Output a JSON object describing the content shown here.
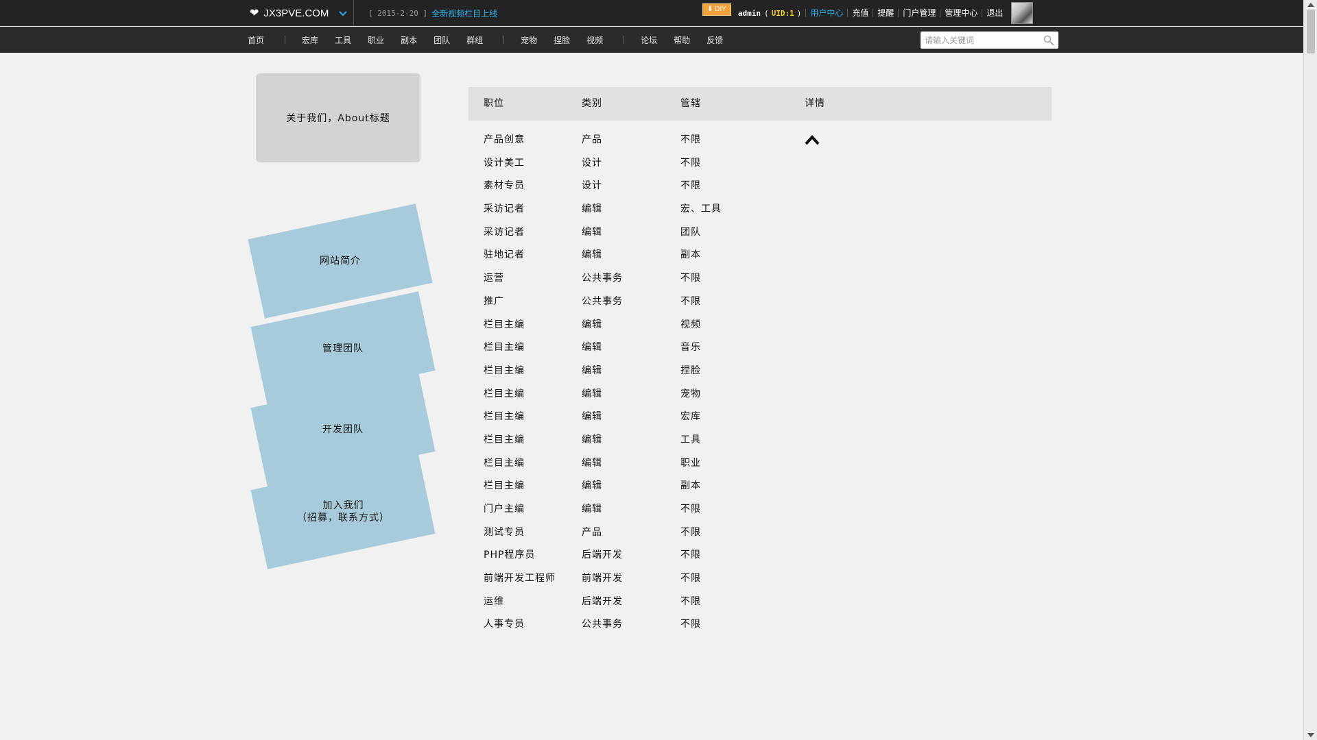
{
  "topbar": {
    "site_name": "JX3PVE.COM",
    "news_date": "[ 2015-2-20 ]",
    "news_link": "全新视频栏目上线",
    "diy_label": "DIY",
    "username": "admin",
    "uid_open": "(",
    "uid_text": "UID:1",
    "uid_close": ")",
    "links": [
      "用户中心",
      "充值",
      "提醒",
      "门户管理",
      "管理中心",
      "退出"
    ]
  },
  "nav": {
    "group1": [
      "首页"
    ],
    "group2": [
      "宏库",
      "工具",
      "职业",
      "副本",
      "团队",
      "群组"
    ],
    "group3": [
      "宠物",
      "捏脸",
      "视频"
    ],
    "group4": [
      "论坛",
      "帮助",
      "反馈"
    ],
    "search_placeholder": "请输入关键词"
  },
  "sidebar": {
    "about_title": "关于我们，About标题",
    "tabs": [
      "网站简介",
      "管理团队",
      "开发团队",
      "加入我们\n（招募，联系方式）"
    ]
  },
  "table": {
    "headers": [
      "职位",
      "类别",
      "管辖",
      "详情"
    ],
    "rows": [
      [
        "产品创意",
        "产品",
        "不限"
      ],
      [
        "设计美工",
        "设计",
        "不限"
      ],
      [
        "素材专员",
        "设计",
        "不限"
      ],
      [
        "采访记者",
        "编辑",
        "宏、工具"
      ],
      [
        "采访记者",
        "编辑",
        "团队"
      ],
      [
        "驻地记者",
        "编辑",
        "副本"
      ],
      [
        "运营",
        "公共事务",
        "不限"
      ],
      [
        "推广",
        "公共事务",
        "不限"
      ],
      [
        "栏目主编",
        "编辑",
        "视频"
      ],
      [
        "栏目主编",
        "编辑",
        "音乐"
      ],
      [
        "栏目主编",
        "编辑",
        "捏脸"
      ],
      [
        "栏目主编",
        "编辑",
        "宠物"
      ],
      [
        "栏目主编",
        "编辑",
        "宏库"
      ],
      [
        "栏目主编",
        "编辑",
        "工具"
      ],
      [
        "栏目主编",
        "编辑",
        "职业"
      ],
      [
        "栏目主编",
        "编辑",
        "副本"
      ],
      [
        "门户主编",
        "编辑",
        "不限"
      ],
      [
        "测试专员",
        "产品",
        "不限"
      ],
      [
        "PHP程序员",
        "后端开发",
        "不限"
      ],
      [
        "前端开发工程师",
        "前端开发",
        "不限"
      ],
      [
        "运维",
        "后端开发",
        "不限"
      ],
      [
        "人事专员",
        "公共事务",
        "不限"
      ]
    ]
  },
  "icons": {
    "heart": "heart-icon",
    "chevron": "chevron-down-icon",
    "search": "search-icon",
    "expand": "chevron-up-icon"
  },
  "colors": {
    "topbar_bg": "#232323",
    "accent_link": "#31b0ea",
    "uid_color": "#f7d32c",
    "tab_bg": "#a8cbdc",
    "about_bg": "#d4d2d2",
    "table_head_bg": "#e1e1e1",
    "page_bg": "#f1f1f1"
  }
}
